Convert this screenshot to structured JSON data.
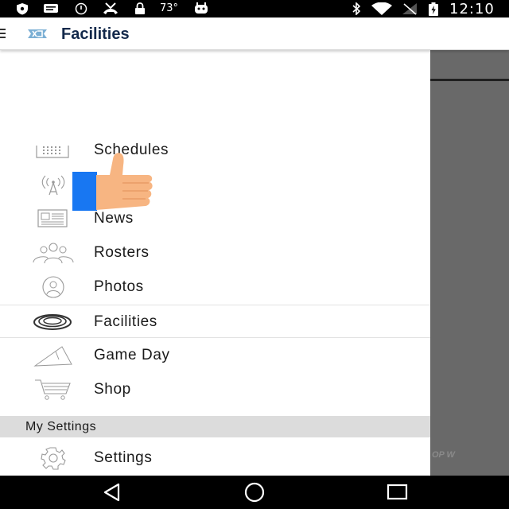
{
  "status_bar": {
    "temperature": "73°",
    "time": "12:10",
    "icons": [
      "shield-icon",
      "message-icon",
      "alarm-icon",
      "missed-call-icon",
      "lock-icon",
      "temp-label",
      "android-icon",
      "bluetooth-icon",
      "wifi-icon",
      "signal-off-icon",
      "battery-icon"
    ]
  },
  "app_bar": {
    "title": "Facilities",
    "logo": "unc-logo-icon",
    "menu_icon": "hamburger-icon"
  },
  "drawer": {
    "items": [
      {
        "label": "Schedules",
        "icon": "calendar-icon"
      },
      {
        "label": "",
        "icon": "radio-tower-icon"
      },
      {
        "label": "News",
        "icon": "newspaper-icon"
      },
      {
        "label": "Rosters",
        "icon": "group-icon"
      },
      {
        "label": "Photos",
        "icon": "person-icon"
      },
      {
        "label": "Facilities",
        "icon": "stadium-icon",
        "active": true
      },
      {
        "label": "Game Day",
        "icon": "pennant-icon"
      },
      {
        "label": "Shop",
        "icon": "cart-icon"
      }
    ],
    "section_header": "My Settings",
    "settings_item": {
      "label": "Settings",
      "icon": "gear-icon"
    }
  },
  "background": {
    "faint_text": "OP W"
  },
  "colors": {
    "brand_navy": "#13294b",
    "carolina_blue": "#7bafd4",
    "scrim": "#696969",
    "section_header_bg": "#dcdcdc",
    "thumb_sleeve": "#1877f2",
    "thumb_skin": "#f7b582"
  },
  "nav_bar": {
    "buttons": [
      "back-icon",
      "home-icon",
      "recents-icon"
    ]
  }
}
